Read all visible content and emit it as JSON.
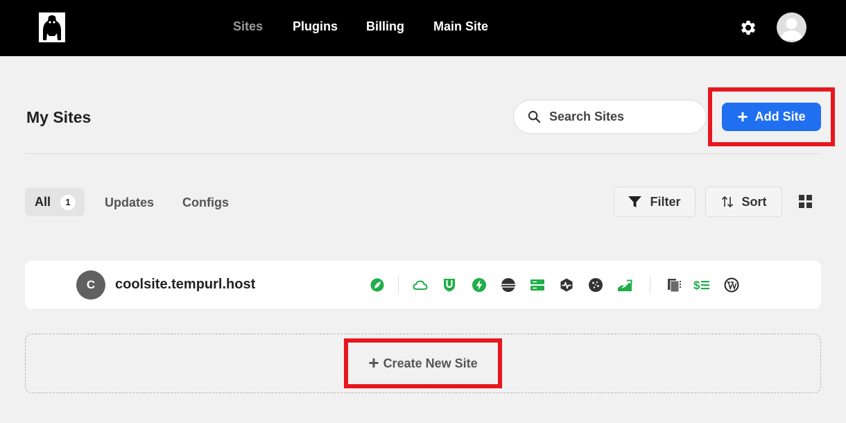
{
  "nav": {
    "items": [
      {
        "label": "Sites",
        "active": true
      },
      {
        "label": "Plugins",
        "active": false
      },
      {
        "label": "Billing",
        "active": false
      },
      {
        "label": "Main Site",
        "active": false
      }
    ],
    "icons": [
      "gorilla-logo-icon",
      "gear-icon",
      "user-avatar-icon"
    ]
  },
  "header": {
    "title": "My Sites",
    "search_placeholder": "Search Sites",
    "add_site_label": "Add Site"
  },
  "tabs": {
    "all_label": "All",
    "all_count": "1",
    "updates_label": "Updates",
    "configs_label": "Configs"
  },
  "toolbar": {
    "filter_label": "Filter",
    "sort_label": "Sort"
  },
  "sites": [
    {
      "initial": "C",
      "name": "coolsite.tempurl.host",
      "status_icons": [
        "leaf-icon",
        "cloud-icon",
        "magnet-shield-icon",
        "bolt-icon",
        "database-icon",
        "server-icon",
        "heartbeat-icon",
        "cookie-icon",
        "chart-growth-icon",
        "documents-icon",
        "dollar-list-icon",
        "wordpress-icon"
      ]
    }
  ],
  "create_new_label": "Create New Site",
  "colors": {
    "accent": "#1f6ff0",
    "status_green": "#1fae47",
    "highlight_red": "#e8161e",
    "topbar": "#000000"
  }
}
